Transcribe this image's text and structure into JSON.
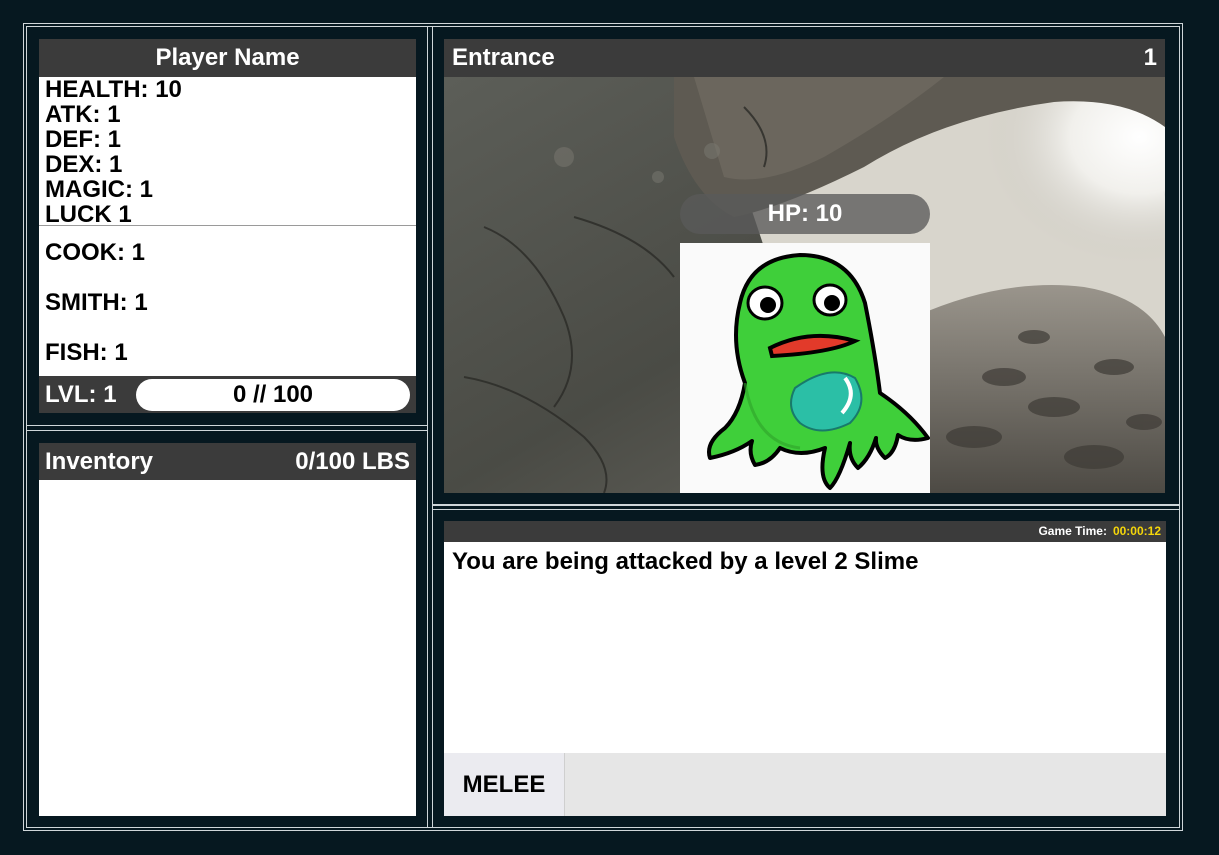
{
  "player": {
    "name": "Player Name",
    "stats": [
      {
        "label": "HEALTH: 10"
      },
      {
        "label": "ATK: 1"
      },
      {
        "label": "DEF: 1"
      },
      {
        "label": "DEX: 1"
      },
      {
        "label": "MAGIC: 1"
      },
      {
        "label": "LUCK 1"
      }
    ],
    "skills": [
      {
        "label": "COOK: 1"
      },
      {
        "label": "SMITH: 1"
      },
      {
        "label": "FISH: 1"
      }
    ],
    "level_label": "LVL: 1",
    "xp_text": "0 // 100",
    "xp_progress": 0
  },
  "inventory": {
    "title": "Inventory",
    "weight": "0/100 LBS"
  },
  "location": {
    "name": "Entrance",
    "floor": "1",
    "enemy": {
      "hp_text": "HP: 10",
      "image": "green-slime-monster"
    }
  },
  "log": {
    "game_time_label": "Game Time:",
    "game_time_value": "00:00:12",
    "message": "You are being attacked by a level 2 Slime"
  },
  "actions": [
    {
      "label": "MELEE"
    }
  ],
  "colors": {
    "background": "#061820",
    "panel_header": "#3b3b3b",
    "game_time": "#f5d60a",
    "slime": "#3fcf3a"
  }
}
